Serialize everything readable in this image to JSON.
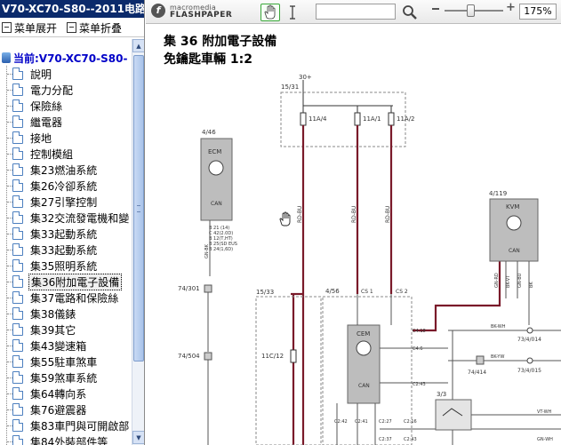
{
  "window": {
    "title": "V70-XC70-S80--2011电路"
  },
  "toolbar": {
    "expand_label": "菜单展开",
    "collapse_label": "菜单折叠"
  },
  "tree": {
    "root_label": "当前:V70-XC70-S80-",
    "items": [
      {
        "label": "說明"
      },
      {
        "label": "電力分配"
      },
      {
        "label": "保險絲"
      },
      {
        "label": "繼電器"
      },
      {
        "label": "接地"
      },
      {
        "label": "控制模組"
      },
      {
        "label": "集23燃油系統"
      },
      {
        "label": "集26冷卻系統"
      },
      {
        "label": "集27引擎控制"
      },
      {
        "label": "集32交流發電機和變"
      },
      {
        "label": "集33起動系統"
      },
      {
        "label": "集33起動系統"
      },
      {
        "label": "集35照明系統"
      },
      {
        "label": "集36附加電子設備"
      },
      {
        "label": "集37電路和保險絲"
      },
      {
        "label": "集38儀錶"
      },
      {
        "label": "集39其它"
      },
      {
        "label": "集43變速箱"
      },
      {
        "label": "集55駐車煞車"
      },
      {
        "label": "集59煞車系統"
      },
      {
        "label": "集64轉向系"
      },
      {
        "label": "集76避震器"
      },
      {
        "label": "集83車門與可開啟部"
      },
      {
        "label": "集84外裝部件等"
      }
    ],
    "selected_index": 13
  },
  "viewer": {
    "brand_line1": "macromedia",
    "brand_line2": "FLASHPAPER",
    "search_value": "",
    "zoom": "175%",
    "zoom_fraction": 0.45
  },
  "document": {
    "title_line1": "集 36 附加電子設備",
    "title_line2": "免鑰匙車輛 1:2"
  },
  "schematic_labels": {
    "ref_30": "30+",
    "ref_15_31": "15/31",
    "f1": "11A/4",
    "f2": "11A/1",
    "f3": "11A/2",
    "ecm_ref": "4/46",
    "ecm_name": "ECM",
    "ecm_can": "CAN",
    "ecm_pins": [
      "B 21 (14)",
      "C 42(2.0D)",
      "B 12(T,HT)",
      "B 25(SD EUS",
      "B 24(1,6D)"
    ],
    "conn1": "74/301",
    "conn2": "74/504",
    "ref_15_33": "15/33",
    "ref_4_56": "4/56",
    "cs1": "CS 1",
    "cs2": "CS 2",
    "wire1": "RD-BU",
    "wire2": "RD-BU",
    "wire3": "RD-BU",
    "wire_ecm": "GN-BK",
    "dev_11c12": "11C/12",
    "cem_name": "CEM",
    "cem_can": "CAN",
    "cem_pins": [
      "C4:18",
      "C4:6",
      "C2:43",
      "C2:42",
      "C2:41",
      "C2:27",
      "C2:37",
      "C2:16",
      "C2:43"
    ],
    "kvm_ref": "4/119",
    "kvm_name": "KVM",
    "kvm_can": "CAN",
    "kvm_wires": [
      "GN-RD",
      "BK-VT",
      "GN-BU",
      "BK"
    ],
    "bk_wh": "BK-WH",
    "bk_yw": "BK-YW",
    "ref_73_4_014": "73/4/014",
    "ref_74_414": "74/414",
    "ref_73_4_015": "73/4/015",
    "ref_3_3": "3/3",
    "vt_wh": "VT-WH",
    "gn_wh": "GN-WH"
  }
}
